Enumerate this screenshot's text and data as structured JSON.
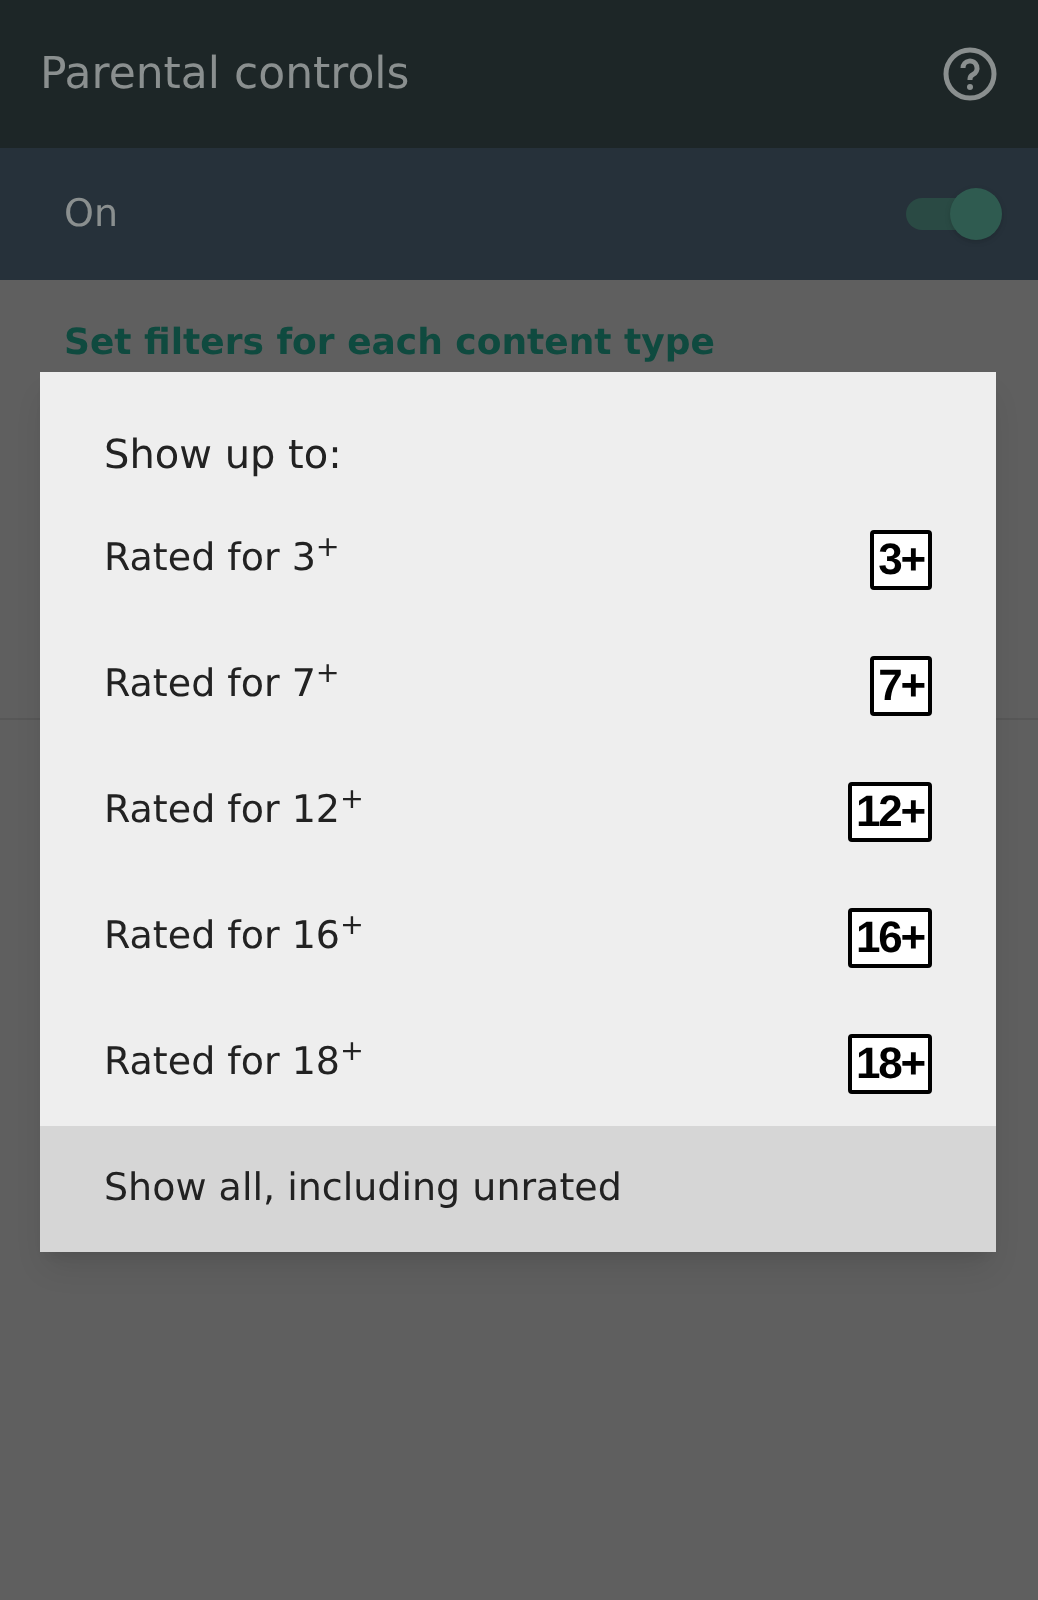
{
  "header": {
    "title": "Parental controls"
  },
  "master_switch": {
    "label": "On",
    "on": true
  },
  "section": {
    "heading": "Set filters for each content type"
  },
  "dialog": {
    "title": "Show up to:",
    "options": [
      {
        "label": "Rated for 3$^{+}$",
        "badge": "3+",
        "selected": false
      },
      {
        "label": "Rated for 7$^{+}$",
        "badge": "7+",
        "selected": false
      },
      {
        "label": "Rated for 12$^{+}$",
        "badge": "12+",
        "selected": false
      },
      {
        "label": "Rated for 16$^{+}$",
        "badge": "16+",
        "selected": false
      },
      {
        "label": "Rated for 18$^{+}$",
        "badge": "18+",
        "selected": false
      },
      {
        "label": "Show all, including unrated",
        "selected": true
      }
    ]
  }
}
